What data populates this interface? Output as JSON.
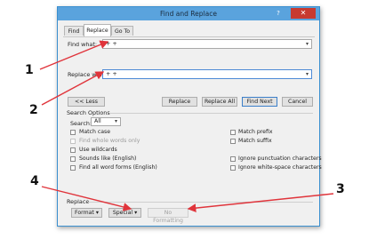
{
  "dialog": {
    "title": "Find and Replace",
    "help": "?",
    "close": "✕"
  },
  "tabs": [
    {
      "label": "Find",
      "active": false
    },
    {
      "label": "Replace",
      "active": true
    },
    {
      "label": "Go To",
      "active": false
    }
  ],
  "find": {
    "label": "Find what:",
    "value": "+ +"
  },
  "replace": {
    "label": "Replace with:",
    "value": "+ +"
  },
  "buttons": {
    "less": "<< Less",
    "replace": "Replace",
    "replace_all": "Replace All",
    "find_next": "Find Next",
    "cancel": "Cancel"
  },
  "search_options": {
    "heading": "Search Options",
    "search_label": "Search:",
    "search_value": "All",
    "left": [
      {
        "label": "Match case",
        "disabled": false
      },
      {
        "label": "Find whole words only",
        "disabled": true
      },
      {
        "label": "Use wildcards",
        "disabled": false
      },
      {
        "label": "Sounds like (English)",
        "disabled": false
      },
      {
        "label": "Find all word forms (English)",
        "disabled": false
      }
    ],
    "right": [
      {
        "label": "Match prefix"
      },
      {
        "label": "Match suffix"
      },
      {
        "label": "Ignore punctuation characters"
      },
      {
        "label": "Ignore white-space characters"
      }
    ]
  },
  "replace_section": {
    "heading": "Replace",
    "format": "Format",
    "special": "Special",
    "no_formatting": "No Formatting"
  },
  "annotations": [
    "1",
    "2",
    "3",
    "4"
  ],
  "colors": {
    "titlebar": "#5aa3dd",
    "close": "#c73a30",
    "arrow": "#e0343b"
  }
}
